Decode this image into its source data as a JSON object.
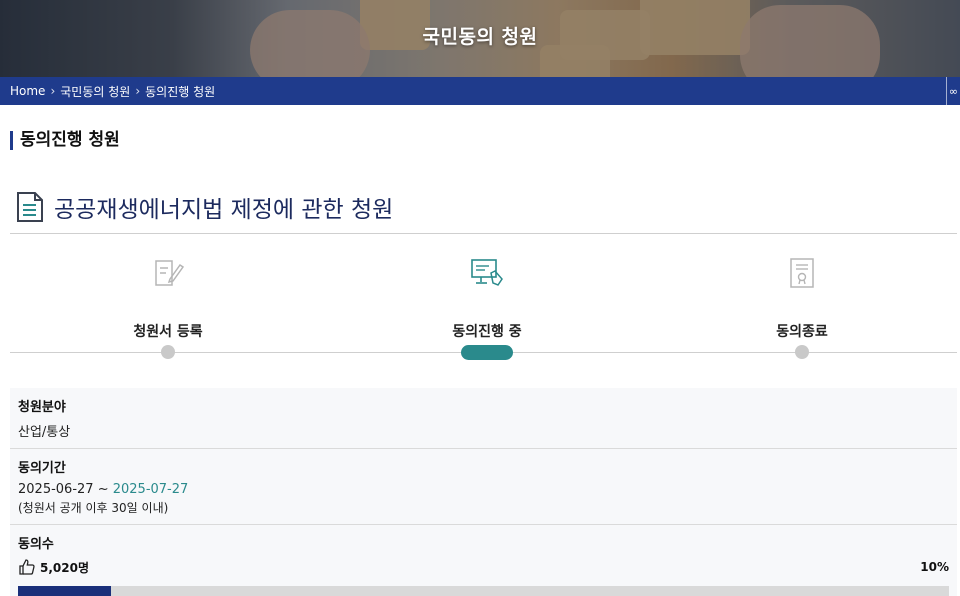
{
  "hero": {
    "title": "국민동의 청원"
  },
  "breadcrumb": {
    "items": [
      "Home",
      "국민동의 청원",
      "동의진행 청원"
    ],
    "edge_glyph": "∞"
  },
  "section_title": "동의진행 청원",
  "petition": {
    "title": "공공재생에너지법 제정에 관한 청원"
  },
  "steps": [
    {
      "label": "청원서 등록",
      "icon": "document-pen-icon",
      "state": "done"
    },
    {
      "label": "동의진행 중",
      "icon": "monitor-hand-icon",
      "state": "current"
    },
    {
      "label": "동의종료",
      "icon": "certificate-icon",
      "state": "pending"
    }
  ],
  "info": {
    "field": {
      "label": "청원분야",
      "value": "산업/통상"
    },
    "period": {
      "label": "동의기간",
      "start": "2025-06-27",
      "separator": " ~ ",
      "end": "2025-07-27",
      "note": "(청원서 공개 이후 30일 이내)"
    },
    "agree": {
      "label": "동의수",
      "count": "5,020명",
      "percent_text": "10%",
      "progress": 0.1
    }
  },
  "colors": {
    "navy": "#1f3b8c",
    "teal": "#2a8a8c",
    "progress_fill": "#1a2f7a",
    "progress_track": "#d9d9d9"
  }
}
